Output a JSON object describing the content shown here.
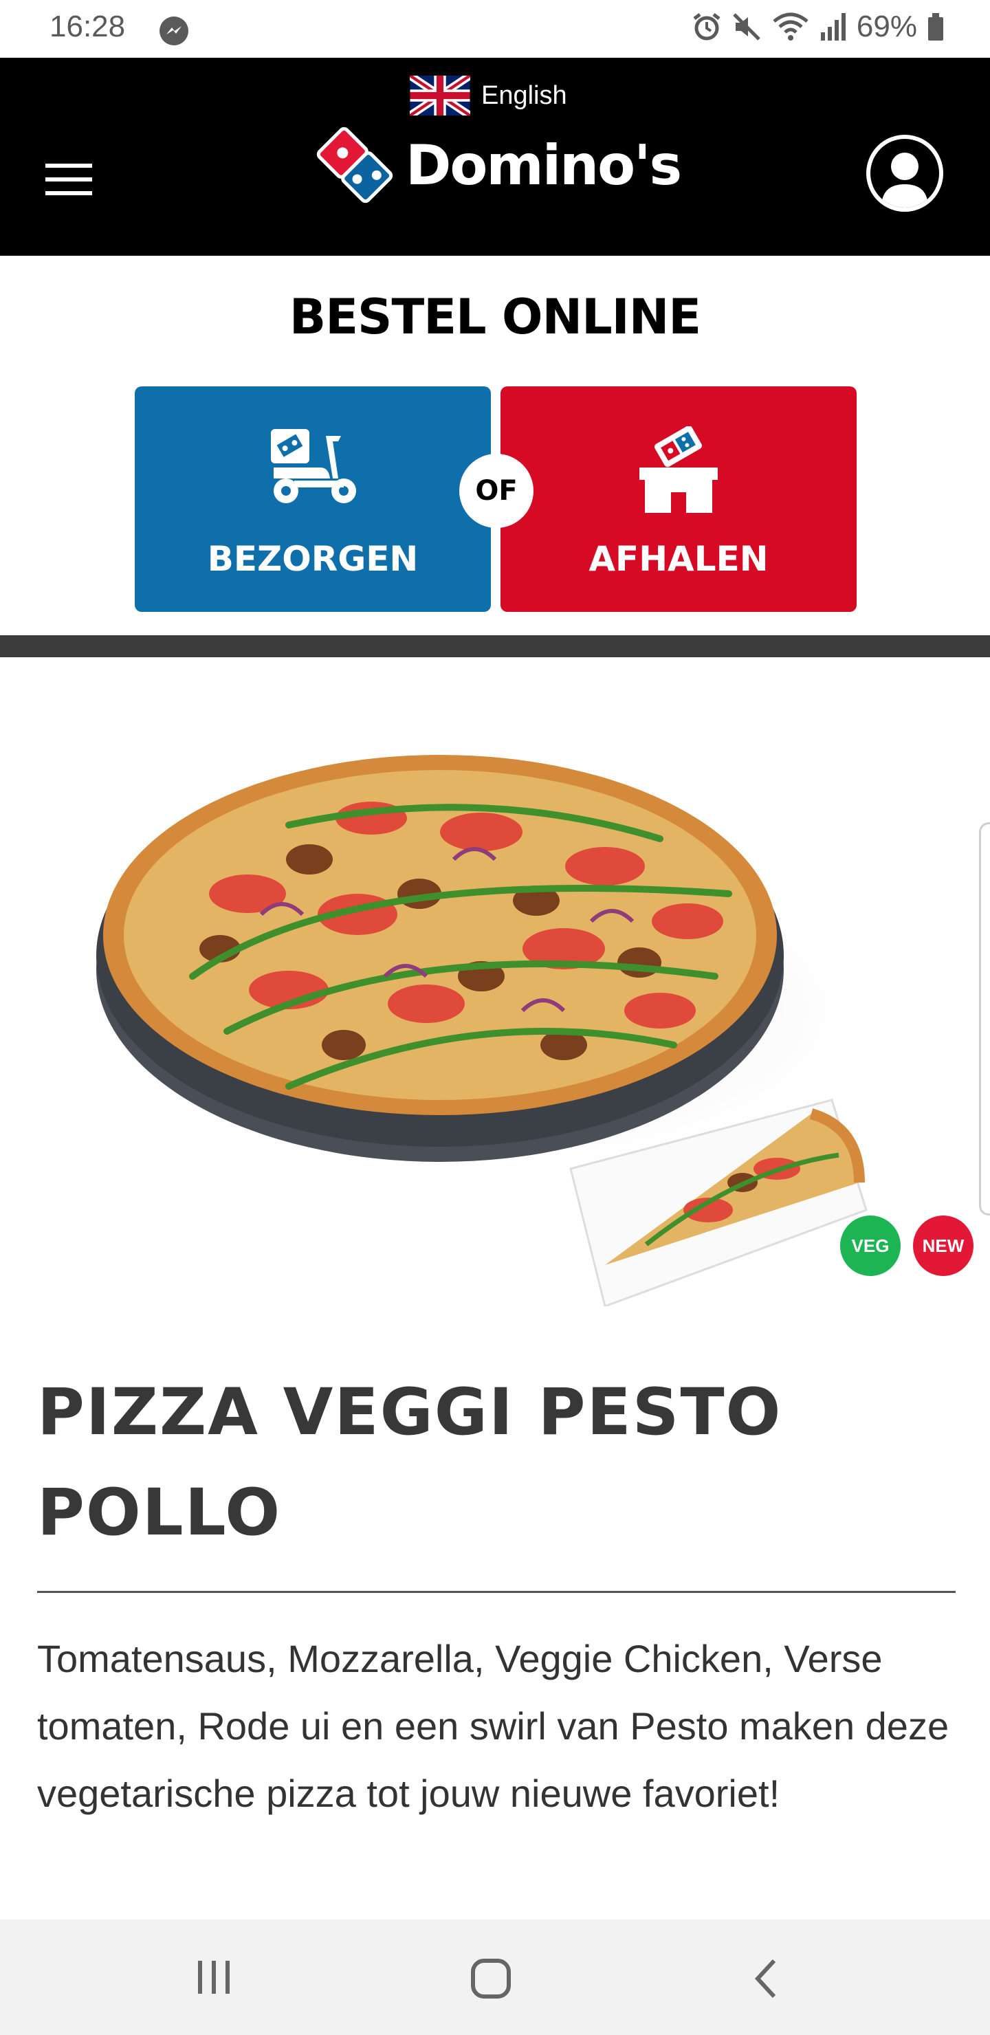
{
  "status_bar": {
    "time": "16:28",
    "battery": "69%",
    "icons": [
      "messenger-icon",
      "alarm-icon",
      "mute-icon",
      "wifi-icon",
      "signal-icon",
      "battery-icon"
    ]
  },
  "header": {
    "language": "English",
    "logo_text": "Domino's",
    "icons": [
      "menu-icon",
      "uk-flag-icon",
      "dominos-logo-icon",
      "account-icon"
    ],
    "colors": {
      "background": "#000000",
      "text": "#ffffff"
    }
  },
  "order": {
    "title": "BESTEL ONLINE",
    "delivery_label": "BEZORGEN",
    "pickup_label": "AFHALEN",
    "or_label": "OF",
    "colors": {
      "delivery": "#0f6fab",
      "pickup": "#d60a24"
    }
  },
  "product": {
    "badges": {
      "veg": "VEG",
      "new": "NEW"
    },
    "title": "PIZZA VEGGI PESTO POLLO",
    "description": "Tomatensaus, Mozzarella, Veggie Chicken, Verse tomaten, Rode ui en een swirl van Pesto maken deze vegetarische pizza tot jouw nieuwe favoriet!",
    "colors": {
      "veg_badge": "#1db553",
      "new_badge": "#e31837"
    }
  },
  "nav_bar": {
    "icons": [
      "recent-apps-icon",
      "home-icon",
      "back-icon"
    ]
  }
}
